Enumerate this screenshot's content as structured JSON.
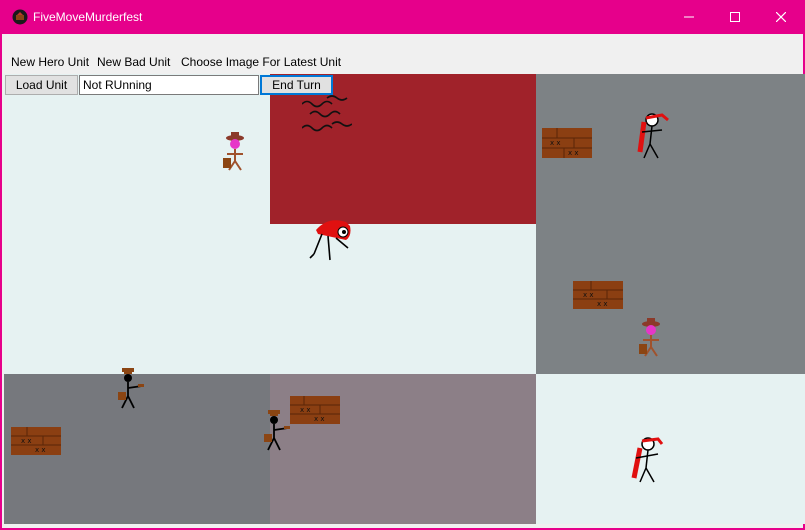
{
  "window": {
    "title": "FiveMoveMurderfest",
    "icon": "app-icon",
    "controls": [
      "minimize-icon",
      "maximize-icon",
      "close-icon"
    ]
  },
  "menu": {
    "items": [
      {
        "label": "New Hero Unit"
      },
      {
        "label": "New Bad Unit"
      },
      {
        "label": "Choose Image For Latest Unit"
      }
    ]
  },
  "toolbar": {
    "load_label": "Load Unit",
    "status_value": "Not RUnning",
    "end_turn_label": "End Turn"
  },
  "board": {
    "cells": [
      {
        "row": 0,
        "col": 0,
        "color": "#e6f2f2",
        "terrain": "plain"
      },
      {
        "row": 0,
        "col": 1,
        "color": "#a0222a",
        "terrain": "lava"
      },
      {
        "row": 0,
        "col": 2,
        "color": "#7d8285",
        "terrain": "stone"
      },
      {
        "row": 1,
        "col": 0,
        "color": "#e6f2f2",
        "terrain": "plain"
      },
      {
        "row": 1,
        "col": 1,
        "color": "#e6f2f2",
        "terrain": "plain"
      },
      {
        "row": 1,
        "col": 2,
        "color": "#7d8285",
        "terrain": "stone"
      },
      {
        "row": 2,
        "col": 0,
        "color": "#76787d",
        "terrain": "stone"
      },
      {
        "row": 2,
        "col": 1,
        "color": "#8c7f87",
        "terrain": "stone"
      },
      {
        "row": 2,
        "col": 2,
        "color": "#e6f2f2",
        "terrain": "plain"
      }
    ],
    "units": [
      {
        "kind": "cowboy-hero",
        "icon": "cowboy-icon"
      },
      {
        "kind": "crate",
        "icon": "crate-icon"
      },
      {
        "kind": "red-ninja",
        "icon": "ninja-icon"
      },
      {
        "kind": "water-waves",
        "icon": "waves-icon"
      },
      {
        "kind": "spider-bad",
        "icon": "spider-icon"
      },
      {
        "kind": "crate",
        "icon": "crate-icon"
      },
      {
        "kind": "cowboy-hero",
        "icon": "cowboy-icon"
      },
      {
        "kind": "gunslinger",
        "icon": "gunslinger-icon"
      },
      {
        "kind": "crate",
        "icon": "crate-icon"
      },
      {
        "kind": "gunslinger",
        "icon": "gunslinger-icon"
      },
      {
        "kind": "crate",
        "icon": "crate-icon"
      },
      {
        "kind": "red-ninja",
        "icon": "ninja-icon"
      }
    ]
  }
}
